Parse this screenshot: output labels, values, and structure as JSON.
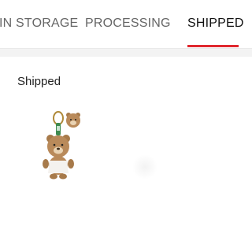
{
  "tabs": [
    {
      "label": "IN STORAGE",
      "active": false
    },
    {
      "label": "PROCESSING",
      "active": false
    },
    {
      "label": "SHIPPED",
      "active": true
    }
  ],
  "accent_color": "#e0282e",
  "section": {
    "title": "Shipped"
  },
  "items": [
    {
      "image_icon": "bear-keychain-plush"
    }
  ]
}
